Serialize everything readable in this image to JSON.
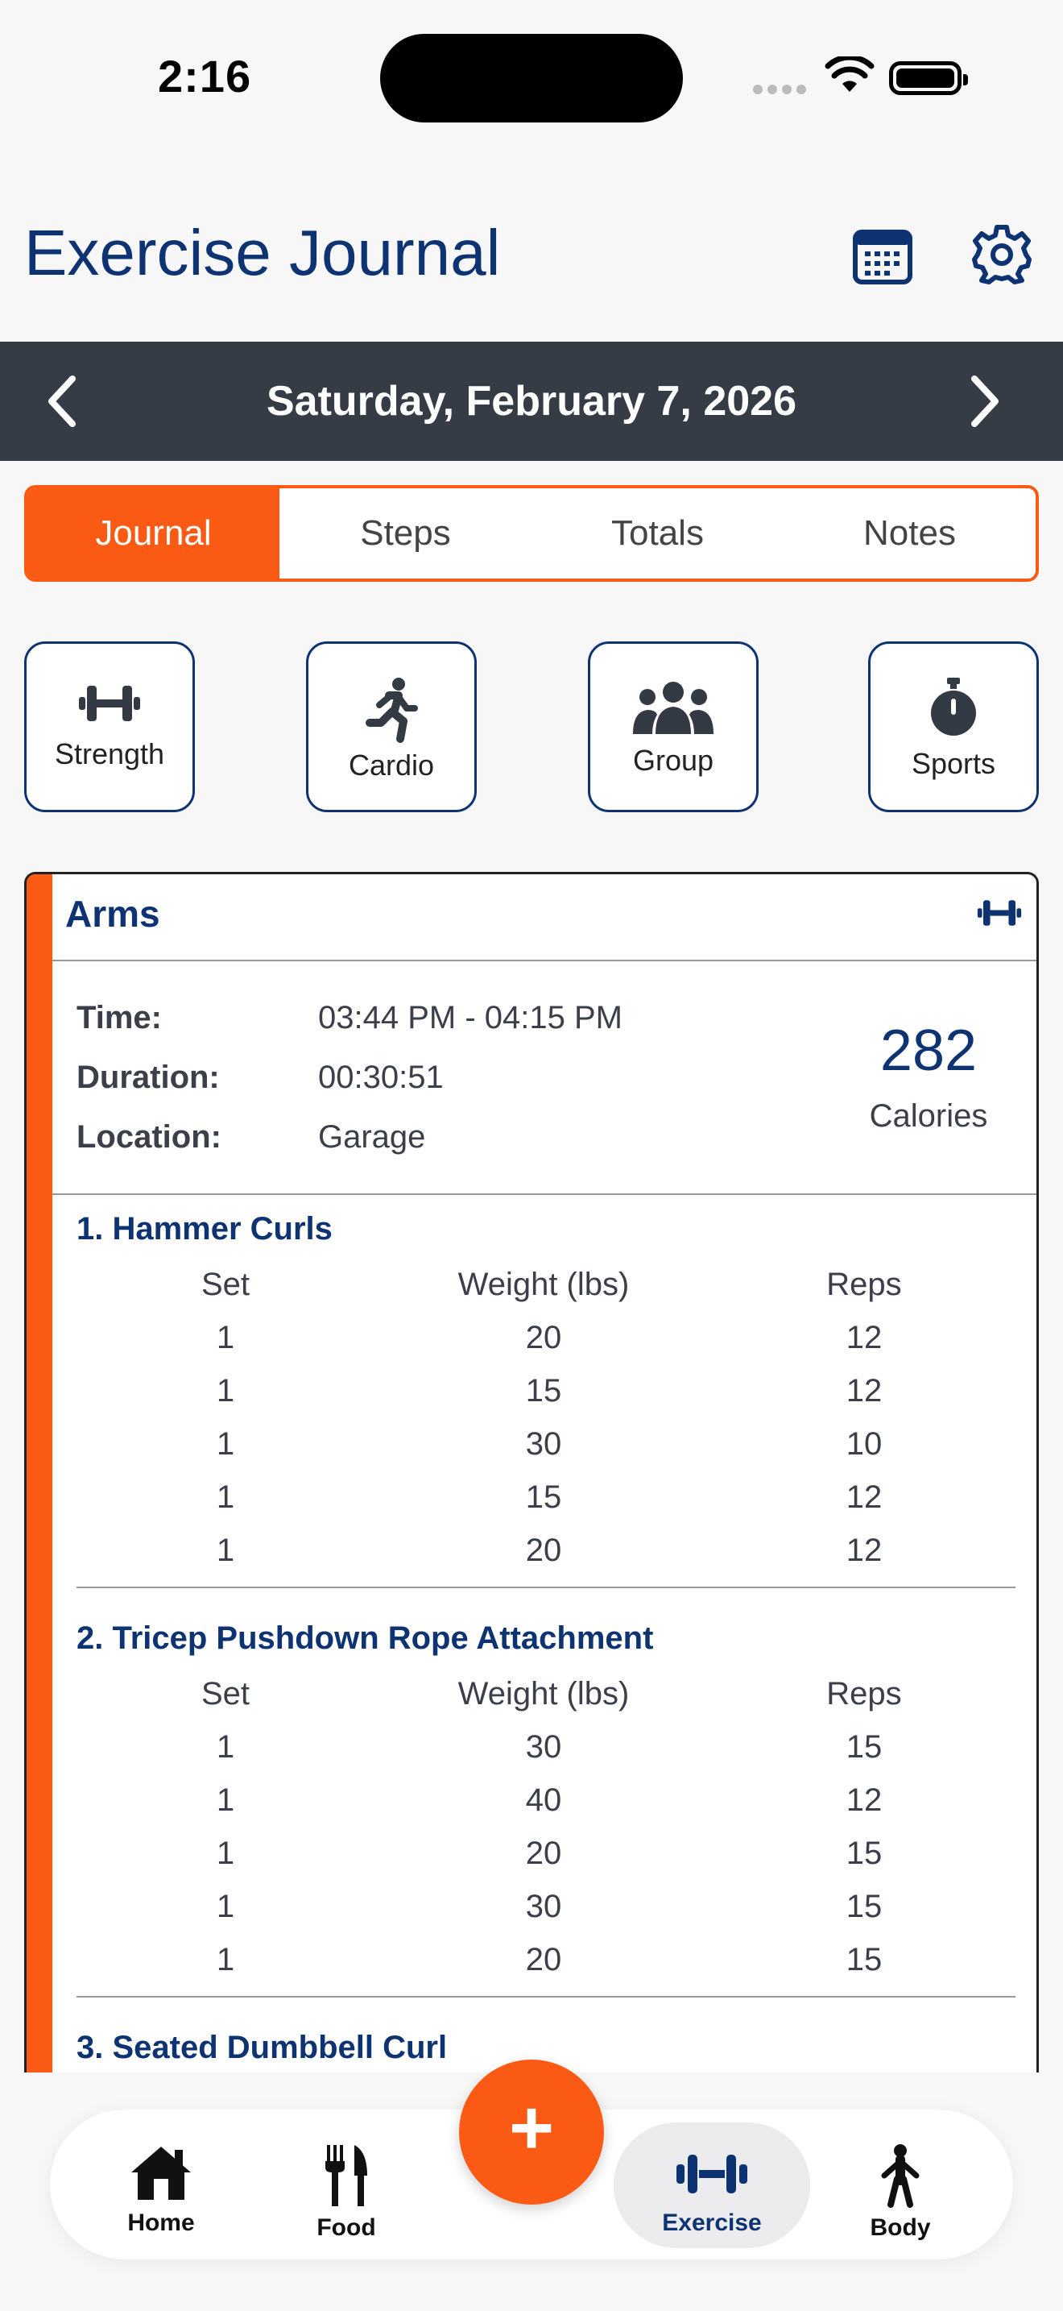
{
  "status": {
    "time": "2:16"
  },
  "header": {
    "title": "Exercise Journal"
  },
  "date_bar": {
    "date": "Saturday, February 7, 2026"
  },
  "tabs": [
    {
      "label": "Journal",
      "active": true
    },
    {
      "label": "Steps",
      "active": false
    },
    {
      "label": "Totals",
      "active": false
    },
    {
      "label": "Notes",
      "active": false
    }
  ],
  "categories": [
    {
      "label": "Strength",
      "icon": "dumbbell-icon"
    },
    {
      "label": "Cardio",
      "icon": "running-icon"
    },
    {
      "label": "Group",
      "icon": "group-icon"
    },
    {
      "label": "Sports",
      "icon": "stopwatch-icon"
    }
  ],
  "workout": {
    "title": "Arms",
    "icon": "dumbbell-icon",
    "time_label": "Time:",
    "time_value": "03:44 PM - 04:15 PM",
    "duration_label": "Duration:",
    "duration_value": "00:30:51",
    "location_label": "Location:",
    "location_value": "Garage",
    "calories_value": "282",
    "calories_label": "Calories",
    "columns": [
      "Set",
      "Weight (lbs)",
      "Reps"
    ],
    "exercises": [
      {
        "name": "1. Hammer Curls",
        "sets": [
          [
            "1",
            "20",
            "12"
          ],
          [
            "1",
            "15",
            "12"
          ],
          [
            "1",
            "30",
            "10"
          ],
          [
            "1",
            "15",
            "12"
          ],
          [
            "1",
            "20",
            "12"
          ]
        ]
      },
      {
        "name": "2. Tricep Pushdown Rope Attachment",
        "sets": [
          [
            "1",
            "30",
            "15"
          ],
          [
            "1",
            "40",
            "12"
          ],
          [
            "1",
            "20",
            "15"
          ],
          [
            "1",
            "30",
            "15"
          ],
          [
            "1",
            "20",
            "15"
          ]
        ]
      },
      {
        "name": "3. Seated Dumbbell Curl",
        "sets": []
      }
    ]
  },
  "nav": {
    "items": [
      {
        "label": "Home",
        "icon": "home-icon",
        "active": false
      },
      {
        "label": "Food",
        "icon": "fork-knife-icon",
        "active": false
      },
      {
        "label": "Exercise",
        "icon": "dumbbell-icon",
        "active": true
      },
      {
        "label": "Body",
        "icon": "person-icon",
        "active": false
      }
    ],
    "fab_label": "+"
  },
  "colors": {
    "accent": "#fb5a14",
    "brand": "#0d3372",
    "date_bar": "#363c46"
  }
}
